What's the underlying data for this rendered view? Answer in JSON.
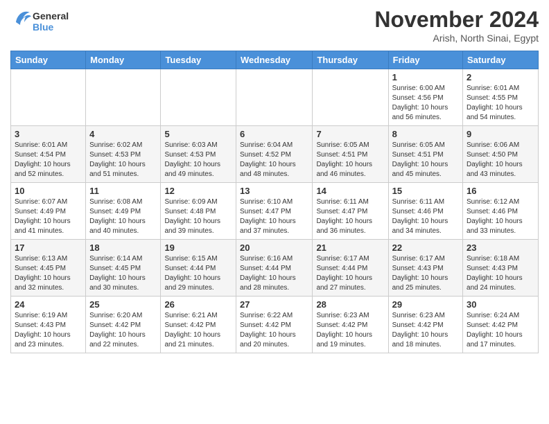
{
  "header": {
    "logo_line1": "General",
    "logo_line2": "Blue",
    "month_title": "November 2024",
    "location": "Arish, North Sinai, Egypt"
  },
  "weekdays": [
    "Sunday",
    "Monday",
    "Tuesday",
    "Wednesday",
    "Thursday",
    "Friday",
    "Saturday"
  ],
  "weeks": [
    [
      {
        "day": "",
        "info": ""
      },
      {
        "day": "",
        "info": ""
      },
      {
        "day": "",
        "info": ""
      },
      {
        "day": "",
        "info": ""
      },
      {
        "day": "",
        "info": ""
      },
      {
        "day": "1",
        "info": "Sunrise: 6:00 AM\nSunset: 4:56 PM\nDaylight: 10 hours and 56 minutes."
      },
      {
        "day": "2",
        "info": "Sunrise: 6:01 AM\nSunset: 4:55 PM\nDaylight: 10 hours and 54 minutes."
      }
    ],
    [
      {
        "day": "3",
        "info": "Sunrise: 6:01 AM\nSunset: 4:54 PM\nDaylight: 10 hours and 52 minutes."
      },
      {
        "day": "4",
        "info": "Sunrise: 6:02 AM\nSunset: 4:53 PM\nDaylight: 10 hours and 51 minutes."
      },
      {
        "day": "5",
        "info": "Sunrise: 6:03 AM\nSunset: 4:53 PM\nDaylight: 10 hours and 49 minutes."
      },
      {
        "day": "6",
        "info": "Sunrise: 6:04 AM\nSunset: 4:52 PM\nDaylight: 10 hours and 48 minutes."
      },
      {
        "day": "7",
        "info": "Sunrise: 6:05 AM\nSunset: 4:51 PM\nDaylight: 10 hours and 46 minutes."
      },
      {
        "day": "8",
        "info": "Sunrise: 6:05 AM\nSunset: 4:51 PM\nDaylight: 10 hours and 45 minutes."
      },
      {
        "day": "9",
        "info": "Sunrise: 6:06 AM\nSunset: 4:50 PM\nDaylight: 10 hours and 43 minutes."
      }
    ],
    [
      {
        "day": "10",
        "info": "Sunrise: 6:07 AM\nSunset: 4:49 PM\nDaylight: 10 hours and 41 minutes."
      },
      {
        "day": "11",
        "info": "Sunrise: 6:08 AM\nSunset: 4:49 PM\nDaylight: 10 hours and 40 minutes."
      },
      {
        "day": "12",
        "info": "Sunrise: 6:09 AM\nSunset: 4:48 PM\nDaylight: 10 hours and 39 minutes."
      },
      {
        "day": "13",
        "info": "Sunrise: 6:10 AM\nSunset: 4:47 PM\nDaylight: 10 hours and 37 minutes."
      },
      {
        "day": "14",
        "info": "Sunrise: 6:11 AM\nSunset: 4:47 PM\nDaylight: 10 hours and 36 minutes."
      },
      {
        "day": "15",
        "info": "Sunrise: 6:11 AM\nSunset: 4:46 PM\nDaylight: 10 hours and 34 minutes."
      },
      {
        "day": "16",
        "info": "Sunrise: 6:12 AM\nSunset: 4:46 PM\nDaylight: 10 hours and 33 minutes."
      }
    ],
    [
      {
        "day": "17",
        "info": "Sunrise: 6:13 AM\nSunset: 4:45 PM\nDaylight: 10 hours and 32 minutes."
      },
      {
        "day": "18",
        "info": "Sunrise: 6:14 AM\nSunset: 4:45 PM\nDaylight: 10 hours and 30 minutes."
      },
      {
        "day": "19",
        "info": "Sunrise: 6:15 AM\nSunset: 4:44 PM\nDaylight: 10 hours and 29 minutes."
      },
      {
        "day": "20",
        "info": "Sunrise: 6:16 AM\nSunset: 4:44 PM\nDaylight: 10 hours and 28 minutes."
      },
      {
        "day": "21",
        "info": "Sunrise: 6:17 AM\nSunset: 4:44 PM\nDaylight: 10 hours and 27 minutes."
      },
      {
        "day": "22",
        "info": "Sunrise: 6:17 AM\nSunset: 4:43 PM\nDaylight: 10 hours and 25 minutes."
      },
      {
        "day": "23",
        "info": "Sunrise: 6:18 AM\nSunset: 4:43 PM\nDaylight: 10 hours and 24 minutes."
      }
    ],
    [
      {
        "day": "24",
        "info": "Sunrise: 6:19 AM\nSunset: 4:43 PM\nDaylight: 10 hours and 23 minutes."
      },
      {
        "day": "25",
        "info": "Sunrise: 6:20 AM\nSunset: 4:42 PM\nDaylight: 10 hours and 22 minutes."
      },
      {
        "day": "26",
        "info": "Sunrise: 6:21 AM\nSunset: 4:42 PM\nDaylight: 10 hours and 21 minutes."
      },
      {
        "day": "27",
        "info": "Sunrise: 6:22 AM\nSunset: 4:42 PM\nDaylight: 10 hours and 20 minutes."
      },
      {
        "day": "28",
        "info": "Sunrise: 6:23 AM\nSunset: 4:42 PM\nDaylight: 10 hours and 19 minutes."
      },
      {
        "day": "29",
        "info": "Sunrise: 6:23 AM\nSunset: 4:42 PM\nDaylight: 10 hours and 18 minutes."
      },
      {
        "day": "30",
        "info": "Sunrise: 6:24 AM\nSunset: 4:42 PM\nDaylight: 10 hours and 17 minutes."
      }
    ]
  ]
}
